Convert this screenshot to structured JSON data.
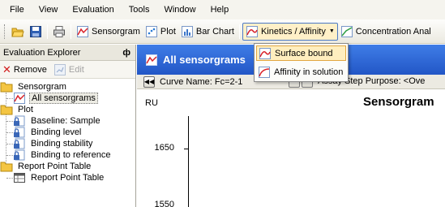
{
  "menu": [
    "File",
    "View",
    "Evaluation",
    "Tools",
    "Window",
    "Help"
  ],
  "toolbar": {
    "sensorgram": "Sensorgram",
    "plot": "Plot",
    "bar_chart": "Bar Chart",
    "kinetics": "Kinetics / Affinity",
    "concentration": "Concentration Anal"
  },
  "explorer": {
    "title": "Evaluation Explorer",
    "pin": "ф",
    "remove": "Remove",
    "edit": "Edit",
    "tree": [
      {
        "label": "Sensorgram"
      },
      {
        "label": "All sensorgrams"
      },
      {
        "label": "Plot"
      },
      {
        "label": "Baseline: Sample"
      },
      {
        "label": "Binding level"
      },
      {
        "label": "Binding stability"
      },
      {
        "label": "Binding to reference"
      },
      {
        "label": "Report Point Table"
      },
      {
        "label": "Report Point Table"
      }
    ]
  },
  "document": {
    "tab_title": "All sensorgrams",
    "curve_name": "Curve Name: Fc=2-1",
    "step_purpose": "Assay Step Purpose: <Ove",
    "y_unit": "RU",
    "chart_title": "Sensorgram",
    "ticks": [
      "1650",
      "1550"
    ]
  },
  "dropdown": {
    "items": [
      "Surface bound",
      "Affinity in solution"
    ]
  },
  "colors": {
    "doc_tab": "#2f6bdc",
    "highlight": "#ffeebf",
    "highlight_border": "#e2a740"
  }
}
